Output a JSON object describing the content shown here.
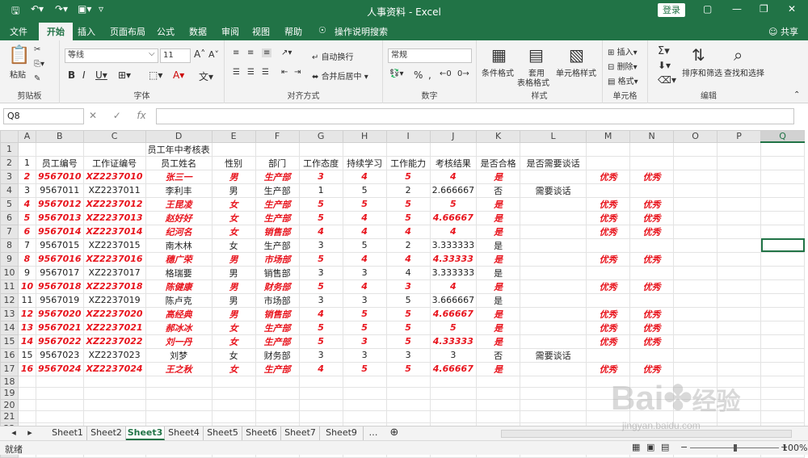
{
  "window": {
    "title": "人事资料 - Excel",
    "login_label": "登录"
  },
  "menu": {
    "tabs": [
      "文件",
      "开始",
      "插入",
      "页面布局",
      "公式",
      "数据",
      "审阅",
      "视图",
      "帮助"
    ],
    "active": "开始",
    "search": "操作说明搜索",
    "share": "共享"
  },
  "ribbon": {
    "clipboard": {
      "label": "剪贴板",
      "paste": "粘贴"
    },
    "font": {
      "label": "字体",
      "name": "等线",
      "size": "11"
    },
    "align": {
      "label": "对齐方式",
      "wrap": "自动换行",
      "merge": "合并后居中"
    },
    "number": {
      "label": "数字",
      "format": "常规"
    },
    "styles": {
      "label": "样式",
      "cond": "条件格式",
      "table": "套用",
      "table2": "表格格式",
      "cell": "单元格样式"
    },
    "cells": {
      "label": "单元格",
      "insert": "插入",
      "delete": "删除",
      "format": "格式"
    },
    "editing": {
      "label": "编辑",
      "sort": "排序和筛选",
      "find": "查找和选择"
    }
  },
  "formula": {
    "namebox": "Q8",
    "fx": "fx",
    "value": ""
  },
  "grid": {
    "columns": [
      "A",
      "B",
      "C",
      "D",
      "E",
      "F",
      "G",
      "H",
      "I",
      "J",
      "K",
      "L",
      "M",
      "N",
      "O",
      "P",
      "Q"
    ],
    "selected_col": "Q",
    "selected_row": 8,
    "title": "员工年中考核表",
    "headers": [
      "1",
      "员工编号",
      "工作证编号",
      "员工姓名",
      "性别",
      "部门",
      "工作态度",
      "持续学习",
      "工作能力",
      "考核结果",
      "是否合格",
      "是否需要谈话"
    ],
    "rows": [
      {
        "cells": [
          "2",
          "9567010",
          "XZ2237010",
          "张三一",
          "男",
          "生产部",
          "3",
          "4",
          "5",
          "4",
          "是",
          "",
          "优秀",
          "优秀"
        ],
        "red": true
      },
      {
        "cells": [
          "3",
          "9567011",
          "XZ2237011",
          "李利丰",
          "男",
          "生产部",
          "1",
          "5",
          "2",
          "2.666667",
          "否",
          "需要谈话",
          "",
          ""
        ],
        "red": false
      },
      {
        "cells": [
          "4",
          "9567012",
          "XZ2237012",
          "王昆凌",
          "女",
          "生产部",
          "5",
          "5",
          "5",
          "5",
          "是",
          "",
          "优秀",
          "优秀"
        ],
        "red": true
      },
      {
        "cells": [
          "5",
          "9567013",
          "XZ2237013",
          "赵好好",
          "女",
          "生产部",
          "5",
          "4",
          "5",
          "4.66667",
          "是",
          "",
          "优秀",
          "优秀"
        ],
        "red": true
      },
      {
        "cells": [
          "6",
          "9567014",
          "XZ2237014",
          "纪河名",
          "女",
          "销售部",
          "4",
          "4",
          "4",
          "4",
          "是",
          "",
          "优秀",
          "优秀"
        ],
        "red": true
      },
      {
        "cells": [
          "7",
          "9567015",
          "XZ2237015",
          "南木林",
          "女",
          "生产部",
          "3",
          "5",
          "2",
          "3.333333",
          "是",
          "",
          "",
          ""
        ],
        "red": false
      },
      {
        "cells": [
          "8",
          "9567016",
          "XZ2237016",
          "穗广荣",
          "男",
          "市场部",
          "5",
          "4",
          "4",
          "4.33333",
          "是",
          "",
          "优秀",
          "优秀"
        ],
        "red": true
      },
      {
        "cells": [
          "9",
          "9567017",
          "XZ2237017",
          "格瑞要",
          "男",
          "销售部",
          "3",
          "3",
          "4",
          "3.333333",
          "是",
          "",
          "",
          ""
        ],
        "red": false
      },
      {
        "cells": [
          "10",
          "9567018",
          "XZ2237018",
          "陈健康",
          "男",
          "财务部",
          "5",
          "4",
          "3",
          "4",
          "是",
          "",
          "优秀",
          "优秀"
        ],
        "red": true
      },
      {
        "cells": [
          "11",
          "9567019",
          "XZ2237019",
          "陈卢克",
          "男",
          "市场部",
          "3",
          "3",
          "5",
          "3.666667",
          "是",
          "",
          "",
          ""
        ],
        "red": false
      },
      {
        "cells": [
          "12",
          "9567020",
          "XZ2237020",
          "高经典",
          "男",
          "销售部",
          "4",
          "5",
          "5",
          "4.66667",
          "是",
          "",
          "优秀",
          "优秀"
        ],
        "red": true
      },
      {
        "cells": [
          "13",
          "9567021",
          "XZ2237021",
          "郝冰冰",
          "女",
          "生产部",
          "5",
          "5",
          "5",
          "5",
          "是",
          "",
          "优秀",
          "优秀"
        ],
        "red": true
      },
      {
        "cells": [
          "14",
          "9567022",
          "XZ2237022",
          "刘一丹",
          "女",
          "生产部",
          "5",
          "3",
          "5",
          "4.33333",
          "是",
          "",
          "优秀",
          "优秀"
        ],
        "red": true
      },
      {
        "cells": [
          "15",
          "9567023",
          "XZ2237023",
          "刘梦",
          "女",
          "财务部",
          "3",
          "3",
          "3",
          "3",
          "否",
          "需要谈话",
          "",
          ""
        ],
        "red": false
      },
      {
        "cells": [
          "16",
          "9567024",
          "XZ2237024",
          "王之秋",
          "女",
          "生产部",
          "4",
          "5",
          "5",
          "4.66667",
          "是",
          "",
          "优秀",
          "优秀"
        ],
        "red": true
      }
    ],
    "row_count": 24
  },
  "sheets": {
    "tabs": [
      "Sheet1",
      "Sheet2",
      "Sheet3",
      "Sheet4",
      "Sheet5",
      "Sheet6",
      "Sheet7",
      "Sheet9"
    ],
    "active": "Sheet3"
  },
  "status": {
    "mode": "就绪",
    "zoom": "100%"
  },
  "watermark": {
    "brand": "Bai",
    "brand2": "经验",
    "url": "jingyan.baidu.com"
  },
  "colors": {
    "accent": "#217346",
    "highlight": "#e8141d"
  }
}
